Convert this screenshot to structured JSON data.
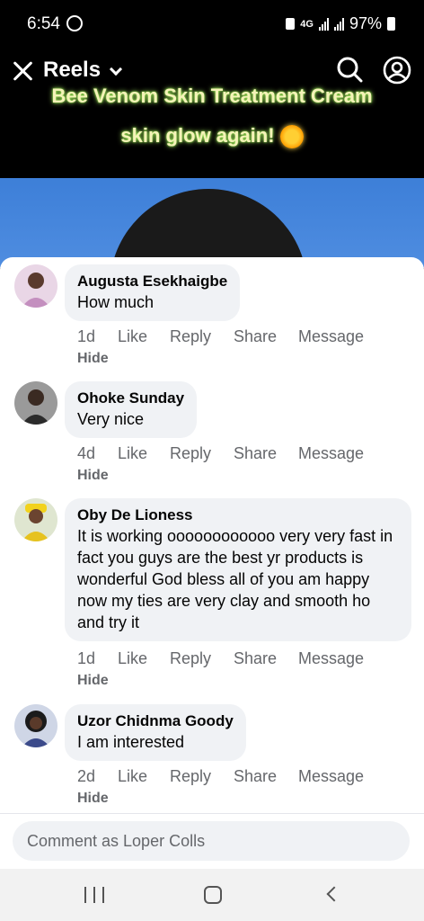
{
  "status_bar": {
    "time": "6:54",
    "network": "4G",
    "battery": "97%"
  },
  "header": {
    "title": "Reels",
    "caption_line1": "Bee Venom Skin Treatment Cream",
    "caption_line2": "skin glow again!"
  },
  "comments": [
    {
      "author": "Augusta Esekhaigbe",
      "text": "How much",
      "time": "1d",
      "avatar_color": "#c9a3c4"
    },
    {
      "author": "Ohoke Sunday",
      "text": "Very nice",
      "time": "4d",
      "avatar_color": "#6b6b6b"
    },
    {
      "author": "Oby De Lioness",
      "text": "It is working oooooooooooo very very fast in fact you guys are the best yr products is wonderful God bless all of you  am happy now my ties are very clay and smooth ho and try it",
      "time": "1d",
      "avatar_color": "#e6c21f"
    },
    {
      "author": "Uzor Chidnma Goody",
      "text": "I am interested",
      "time": "2d",
      "avatar_color": "#3b4a8a"
    }
  ],
  "actions": {
    "like": "Like",
    "reply": "Reply",
    "share": "Share",
    "message": "Message",
    "hide": "Hide"
  },
  "comment_input": {
    "placeholder": "Comment as Loper Colls"
  },
  "colors": {
    "bubble_bg": "#f0f2f5",
    "meta_text": "#65676b",
    "caption_glow": "#b6ff6a"
  }
}
